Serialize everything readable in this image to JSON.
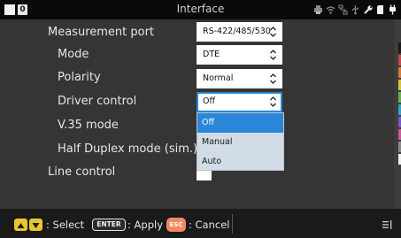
{
  "topbar": {
    "title": "Interface",
    "badge": "0",
    "status_icons": [
      "printer-icon",
      "wifi-icon",
      "network-icon",
      "usb-icon",
      "tool-icon",
      "sd-card-icon",
      "plug-icon"
    ]
  },
  "form": {
    "rows": [
      {
        "label": "Measurement port",
        "value": "RS-422/485/530"
      },
      {
        "label": "Mode",
        "value": "DTE"
      },
      {
        "label": "Polarity",
        "value": "Normal"
      },
      {
        "label": "Driver control",
        "value": "Off"
      },
      {
        "label": "V.35 mode"
      },
      {
        "label": "Half Duplex mode (sim.)"
      },
      {
        "label": "Line control"
      }
    ]
  },
  "dropdown": {
    "options": [
      "Off",
      "Manual",
      "Auto"
    ],
    "selected": "Off"
  },
  "footer": {
    "select_text": ": Select",
    "enter_key": "ENTER",
    "apply_text": ": Apply",
    "esc_key": "ESC",
    "cancel_text": ": Cancel"
  },
  "colors": {
    "accent": "#2a86d8",
    "arrow_keys": "#e8c72e",
    "esc_key": "#f08a64",
    "background": "#353535"
  }
}
